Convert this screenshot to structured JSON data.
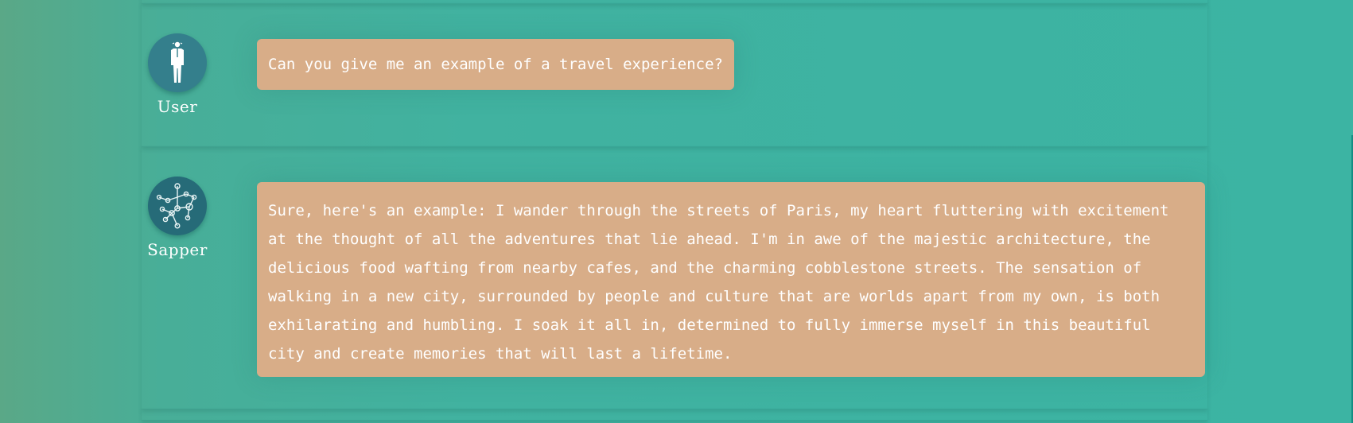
{
  "colors": {
    "bubble": "#d8ad88",
    "user_avatar": "#347f8c",
    "bot_avatar": "#266b78",
    "background": "#3db3a2"
  },
  "messages": [
    {
      "author": "User",
      "avatar_icon": "person-icon",
      "text": "Can you give me an example of a travel experience?"
    },
    {
      "author": "Sapper",
      "avatar_icon": "network-icon",
      "text": "Sure, here's an example: I wander through the streets of Paris, my heart fluttering with excitement at the thought of all the adventures that lie ahead. I'm in awe of the majestic architecture, the delicious food wafting from nearby cafes, and the charming cobblestone streets. The sensation of walking in a new city, surrounded by people and culture that are worlds apart from my own, is both exhilarating and humbling. I soak it all in, determined to fully immerse myself in this beautiful city and create memories that will last a lifetime."
    }
  ]
}
